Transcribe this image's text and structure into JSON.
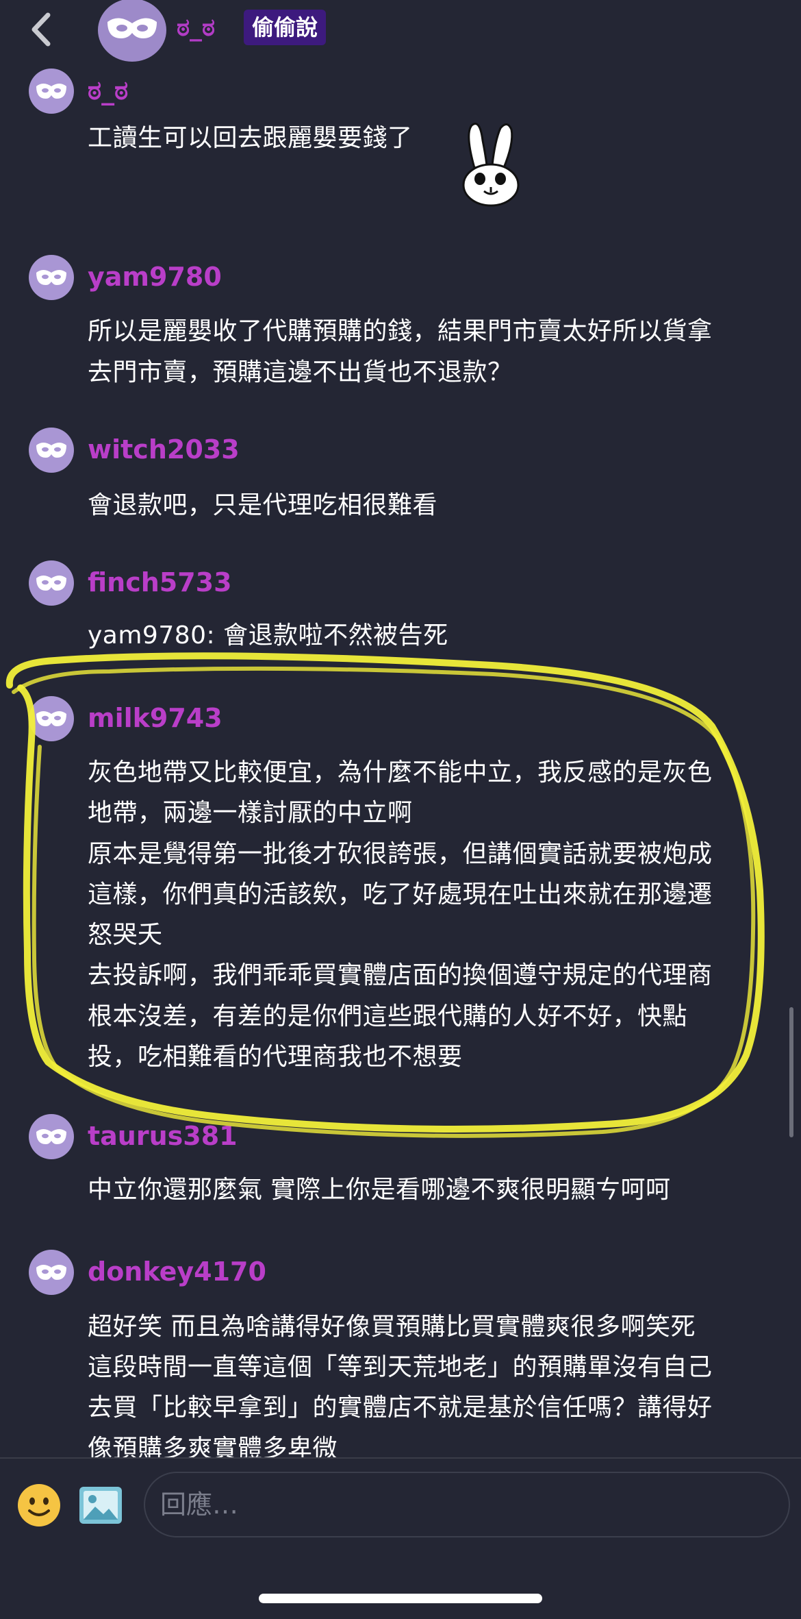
{
  "header": {
    "name": "ಠ_ಠ",
    "badge": "偷偷說"
  },
  "comments": [
    {
      "user": "ಠ_ಠ",
      "lines": [
        "工讀生可以回去跟麗嬰要錢了"
      ],
      "sticker": "bunny-sticker"
    },
    {
      "user": "yam9780",
      "lines": [
        "所以是麗嬰收了代購預購的錢，結果門市賣太好所以貨拿",
        "去門市賣，預購這邊不出貨也不退款？"
      ]
    },
    {
      "user": "witch2033",
      "lines": [
        "會退款吧，只是代理吃相很難看"
      ]
    },
    {
      "user": "finch5733",
      "lines": [
        "yam9780: 會退款啦不然被告死"
      ]
    },
    {
      "user": "milk9743",
      "lines": [
        "灰色地帶又比較便宜，為什麼不能中立，我反感的是灰色",
        "地帶，兩邊一樣討厭的中立啊",
        "原本是覺得第一批後才砍很誇張，但講個實話就要被炮成",
        "這樣，你們真的活該欸，吃了好處現在吐出來就在那邊遷",
        "怒哭夭",
        "去投訴啊，我們乖乖買實體店面的換個遵守規定的代理商",
        "根本沒差，有差的是你們這些跟代購的人好不好，快點",
        "投，吃相難看的代理商我也不想要"
      ]
    },
    {
      "user": "taurus381",
      "lines": [
        "中立你還那麼氣 實際上你是看哪邊不爽很明顯ㄘ呵呵"
      ]
    },
    {
      "user": "donkey4170",
      "lines": [
        "超好笑 而且為啥講得好像買預購比買實體爽很多啊笑死",
        "這段時間一直等這個「等到天荒地老」的預購單沒有自己",
        "去買「比較早拿到」的實體店不就是基於信任嗎？講得好",
        "像預購多爽實體多卑微"
      ]
    }
  ],
  "composer": {
    "placeholder": "回應…"
  },
  "colors": {
    "background": "#242634",
    "username": "#b93ec8",
    "badge": "#3d1a7e",
    "avatar": "#a996d4",
    "highlight": "#f2ef3a"
  }
}
